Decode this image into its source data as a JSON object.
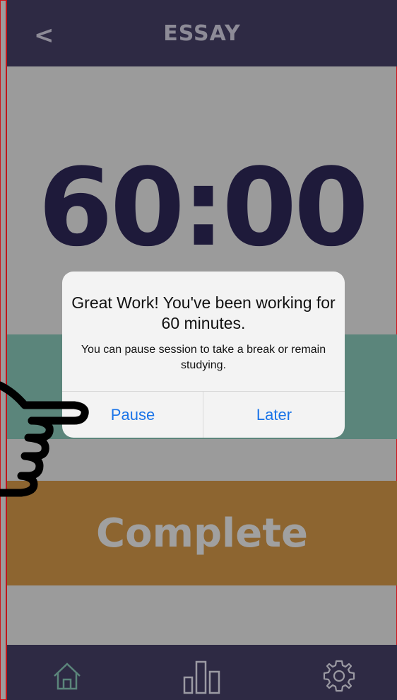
{
  "header": {
    "back_label": "<",
    "title": "ESSAY"
  },
  "timer": {
    "display": "60:00"
  },
  "complete": {
    "label": "Complete"
  },
  "alert": {
    "title": "Great Work! You've been working for 60 minutes.",
    "message": "You can pause session to take a break or remain studying.",
    "pause_label": "Pause",
    "later_label": "Later"
  },
  "tabbar": {
    "icons": [
      "home-icon",
      "stats-icon",
      "gear-icon"
    ]
  },
  "colors": {
    "header_bg": "#2e2a44",
    "teal": "#5b857b",
    "complete": "#8d6530",
    "link_blue": "#1a74e8"
  }
}
